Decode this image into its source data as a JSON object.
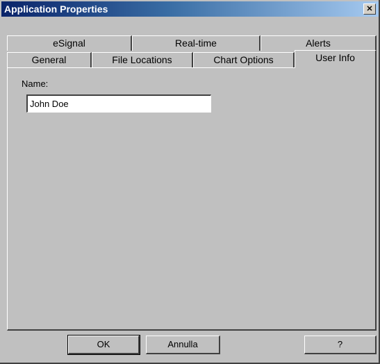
{
  "window": {
    "title": "Application Properties",
    "close_icon": "close-icon"
  },
  "tabs": {
    "back_row": [
      "eSignal",
      "Real-time",
      "Alerts"
    ],
    "front_row": [
      "General",
      "File Locations",
      "Chart Options",
      "User Info"
    ],
    "active": "User Info"
  },
  "user_info": {
    "name_label": "Name:",
    "name_value": "John Doe"
  },
  "buttons": {
    "ok": "OK",
    "cancel": "Annulla",
    "help": "?"
  }
}
